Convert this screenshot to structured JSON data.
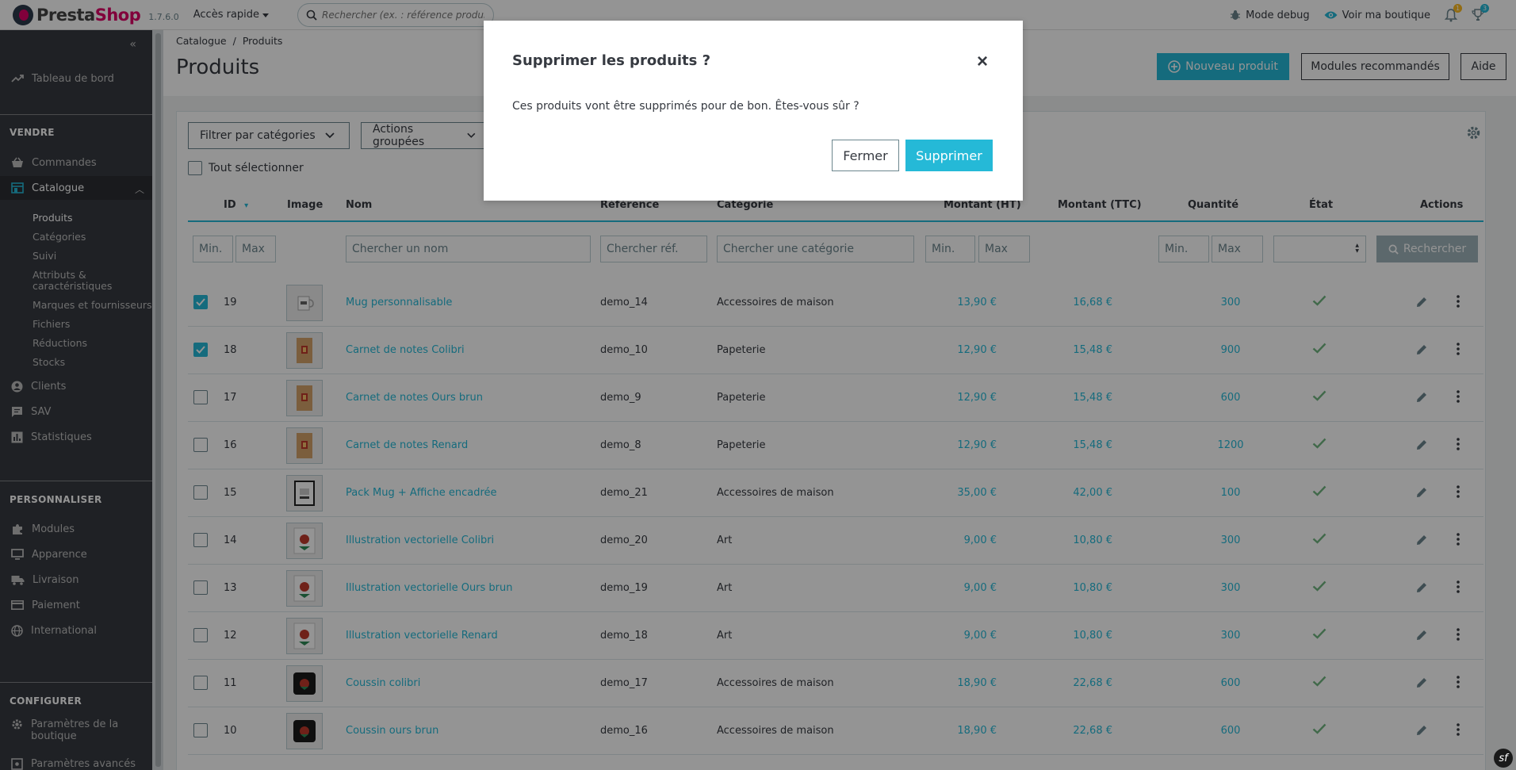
{
  "topbar": {
    "logo_prefix": "Presta",
    "logo_suffix": "Shop",
    "version": "1.7.6.0",
    "quick_access": "Accès rapide",
    "search_placeholder": "Rechercher (ex. : référence produit, nom",
    "debug_mode": "Mode debug",
    "view_shop": "Voir ma boutique",
    "notif_orders_count": "1",
    "notif_customers_count": "3"
  },
  "sidebar": {
    "dashboard": "Tableau de bord",
    "section_sell": "VENDRE",
    "orders": "Commandes",
    "catalog": "Catalogue",
    "catalog_sub": [
      "Produits",
      "Catégories",
      "Suivi",
      "Attributs & caractéristiques",
      "Marques et fournisseurs",
      "Fichiers",
      "Réductions",
      "Stocks"
    ],
    "customers": "Clients",
    "sav": "SAV",
    "stats": "Statistiques",
    "section_customize": "PERSONNALISER",
    "modules": "Modules",
    "appearance": "Apparence",
    "shipping": "Livraison",
    "payment": "Paiement",
    "international": "International",
    "section_configure": "CONFIGURER",
    "shop_params": "Paramètres de la boutique",
    "advanced_params": "Paramètres avancés"
  },
  "header": {
    "breadcrumb_parent": "Catalogue",
    "breadcrumb_sep": "/",
    "breadcrumb_current": "Produits",
    "title": "Produits",
    "new_product": "Nouveau produit",
    "recommended_modules": "Modules recommandés",
    "help": "Aide"
  },
  "toolbar": {
    "filter_categories": "Filtrer par catégories",
    "bulk_actions": "Actions groupées",
    "select_all": "Tout sélectionner"
  },
  "table": {
    "headers": {
      "id": "ID",
      "image": "Image",
      "name": "Nom",
      "reference": "Référence",
      "category": "Catégorie",
      "price_ht": "Montant (HT)",
      "price_ttc": "Montant (TTC)",
      "quantity": "Quantité",
      "state": "État",
      "actions": "Actions"
    },
    "filters": {
      "min": "Min.",
      "max": "Max",
      "name": "Chercher un nom",
      "ref": "Chercher réf.",
      "category": "Chercher une catégorie",
      "search_button": "Rechercher"
    },
    "rows": [
      {
        "checked": true,
        "id": "19",
        "name": "Mug personnalisable",
        "ref": "demo_14",
        "cat": "Accessoires de maison",
        "ht": "13,90 €",
        "ttc": "16,68 €",
        "qty": "300",
        "img": "mug"
      },
      {
        "checked": true,
        "id": "18",
        "name": "Carnet de notes Colibri",
        "ref": "demo_10",
        "cat": "Papeterie",
        "ht": "12,90 €",
        "ttc": "15,48 €",
        "qty": "900",
        "img": "notebook"
      },
      {
        "checked": false,
        "id": "17",
        "name": "Carnet de notes Ours brun",
        "ref": "demo_9",
        "cat": "Papeterie",
        "ht": "12,90 €",
        "ttc": "15,48 €",
        "qty": "600",
        "img": "notebook"
      },
      {
        "checked": false,
        "id": "16",
        "name": "Carnet de notes Renard",
        "ref": "demo_8",
        "cat": "Papeterie",
        "ht": "12,90 €",
        "ttc": "15,48 €",
        "qty": "1200",
        "img": "notebook"
      },
      {
        "checked": false,
        "id": "15",
        "name": "Pack Mug + Affiche encadrée",
        "ref": "demo_21",
        "cat": "Accessoires de maison",
        "ht": "35,00 €",
        "ttc": "42,00 €",
        "qty": "100",
        "img": "frame"
      },
      {
        "checked": false,
        "id": "14",
        "name": "Illustration vectorielle Colibri",
        "ref": "demo_20",
        "cat": "Art",
        "ht": "9,00 €",
        "ttc": "10,80 €",
        "qty": "300",
        "img": "illustration"
      },
      {
        "checked": false,
        "id": "13",
        "name": "Illustration vectorielle Ours brun",
        "ref": "demo_19",
        "cat": "Art",
        "ht": "9,00 €",
        "ttc": "10,80 €",
        "qty": "300",
        "img": "illustration"
      },
      {
        "checked": false,
        "id": "12",
        "name": "Illustration vectorielle Renard",
        "ref": "demo_18",
        "cat": "Art",
        "ht": "9,00 €",
        "ttc": "10,80 €",
        "qty": "300",
        "img": "illustration"
      },
      {
        "checked": false,
        "id": "11",
        "name": "Coussin colibri",
        "ref": "demo_17",
        "cat": "Accessoires de maison",
        "ht": "18,90 €",
        "ttc": "22,68 €",
        "qty": "600",
        "img": "cushion"
      },
      {
        "checked": false,
        "id": "10",
        "name": "Coussin ours brun",
        "ref": "demo_16",
        "cat": "Accessoires de maison",
        "ht": "18,90 €",
        "ttc": "22,68 €",
        "qty": "600",
        "img": "cushion"
      }
    ]
  },
  "modal": {
    "title": "Supprimer les produits ?",
    "close": "×",
    "body": "Ces produits vont être supprimés pour de bon. Êtes-vous sûr ?",
    "cancel": "Fermer",
    "confirm": "Supprimer"
  },
  "colors": {
    "primary": "#25b9d7",
    "sidebar_bg": "#363a41",
    "success": "#70b580",
    "brand": "#df0067"
  },
  "icons": {
    "symfony": "sf"
  }
}
